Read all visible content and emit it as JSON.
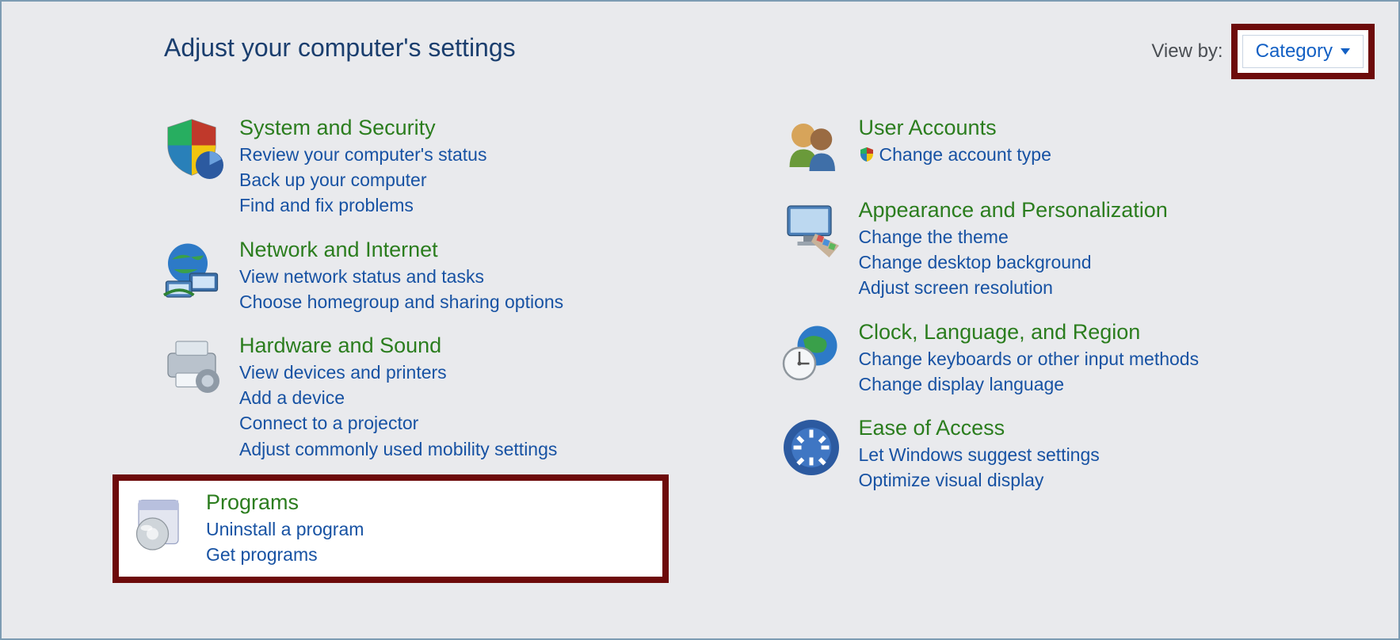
{
  "title": "Adjust your computer's settings",
  "viewby": {
    "label": "View by:",
    "value": "Category"
  },
  "left": [
    {
      "title": "System and Security",
      "links": [
        "Review your computer's status",
        "Back up your computer",
        "Find and fix problems"
      ]
    },
    {
      "title": "Network and Internet",
      "links": [
        "View network status and tasks",
        "Choose homegroup and sharing options"
      ]
    },
    {
      "title": "Hardware and Sound",
      "links": [
        "View devices and printers",
        "Add a device",
        "Connect to a projector",
        "Adjust commonly used mobility settings"
      ]
    },
    {
      "title": "Programs",
      "links": [
        "Uninstall a program",
        "Get programs"
      ]
    }
  ],
  "right": [
    {
      "title": "User Accounts",
      "links": [
        "Change account type"
      ],
      "shield": [
        true
      ]
    },
    {
      "title": "Appearance and Personalization",
      "links": [
        "Change the theme",
        "Change desktop background",
        "Adjust screen resolution"
      ]
    },
    {
      "title": "Clock, Language, and Region",
      "links": [
        "Change keyboards or other input methods",
        "Change display language"
      ]
    },
    {
      "title": "Ease of Access",
      "links": [
        "Let Windows suggest settings",
        "Optimize visual display"
      ]
    }
  ]
}
